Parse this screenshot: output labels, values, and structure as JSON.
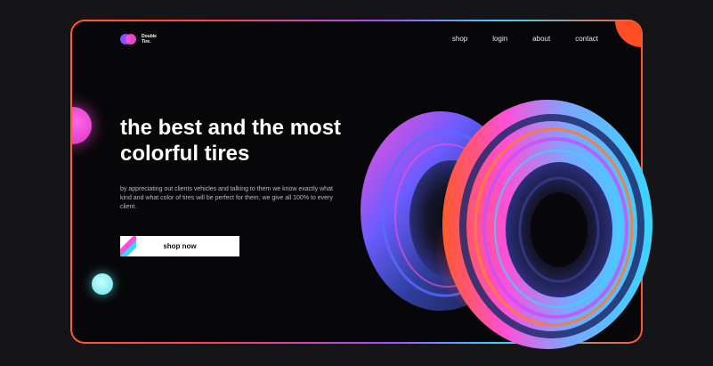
{
  "brand": {
    "name_line1": "Double",
    "name_line2": "Tire."
  },
  "nav": {
    "items": [
      "shop",
      "login",
      "about",
      "contact"
    ]
  },
  "hero": {
    "headline": "the best and the most colorful tires",
    "description": "by appreciating out clients vehicles and talking to them we know exactly what kind and what color of tires will be perfect for them, we give all 100% to every client.",
    "cta_label": "shop now"
  },
  "colors": {
    "accent_orange": "#ff4d24",
    "accent_pink": "#ff4fd8",
    "accent_cyan": "#5fe3ee",
    "accent_purple": "#8a4dff",
    "background": "#070709"
  }
}
